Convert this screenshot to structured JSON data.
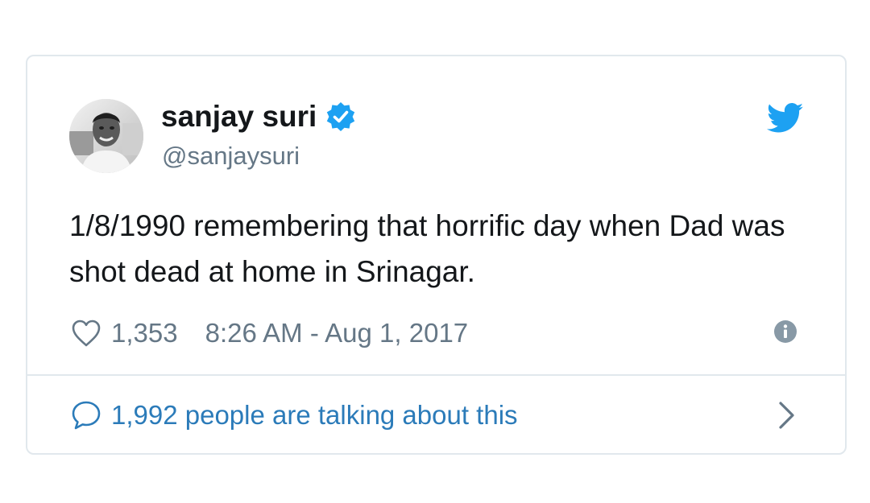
{
  "tweet": {
    "display_name": "sanjay suri",
    "handle": "@sanjaysuri",
    "text": "1/8/1990 remembering that horrific day when Dad was shot dead at home in Srinagar.",
    "likes": "1,353",
    "timestamp": "8:26 AM - Aug 1, 2017",
    "verified": true
  },
  "footer": {
    "talking_text": "1,992 people are talking about this"
  },
  "icons": {
    "verified": "verified-badge-icon",
    "brand": "twitter-bird-icon",
    "like": "heart-icon",
    "info": "info-icon",
    "reply": "speech-bubble-icon",
    "more": "chevron-right-icon"
  },
  "colors": {
    "brand_blue": "#1da1f2",
    "link_blue": "#2b7bb9",
    "text_primary": "#14171a",
    "text_secondary": "#657786",
    "border": "#e1e8ed"
  }
}
